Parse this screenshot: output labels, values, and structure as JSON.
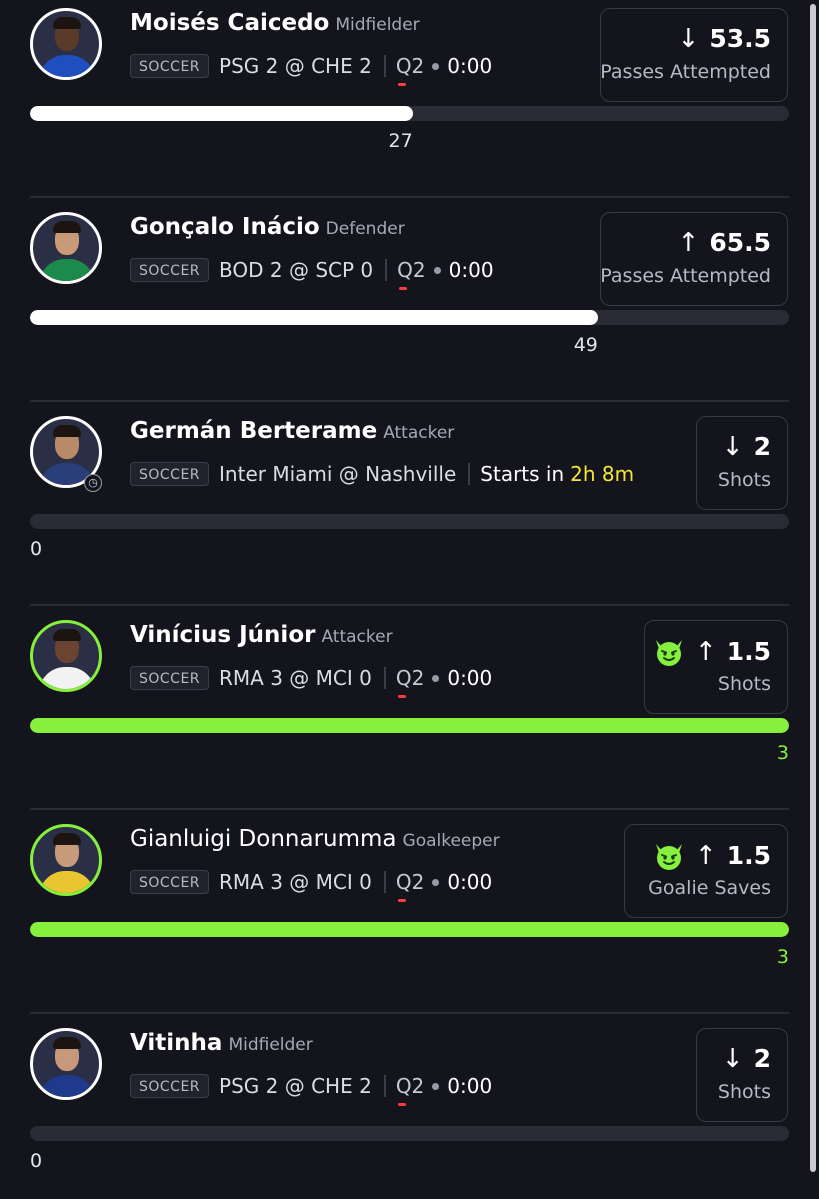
{
  "scrollbar": true,
  "colors": {
    "background": "#14141d",
    "win_accent": "#86f03c",
    "countdown": "#f5e63a",
    "live_indicator": "#ff3b3b"
  },
  "picks": [
    {
      "player": "Moisés Caicedo",
      "position": "Midfielder",
      "sport": "SOCCER",
      "matchup": "PSG 2 @ CHE 2",
      "period": "Q2",
      "clock": "0:00",
      "direction": "down",
      "arrow": "↓",
      "line": "53.5",
      "stat": "Passes Attempted",
      "current": "27",
      "progress_fraction": 0.504,
      "status": "live",
      "avatar_colors": {
        "skin": "#5a3a28",
        "shirt": "#1f4fbf"
      }
    },
    {
      "player": "Gonçalo Inácio",
      "position": "Defender",
      "sport": "SOCCER",
      "matchup": "BOD 2 @ SCP 0",
      "period": "Q2",
      "clock": "0:00",
      "direction": "up",
      "arrow": "↑",
      "line": "65.5",
      "stat": "Passes Attempted",
      "current": "49",
      "progress_fraction": 0.748,
      "status": "live",
      "avatar_colors": {
        "skin": "#c99a78",
        "shirt": "#1c8a4a"
      }
    },
    {
      "player": "Germán Berterame",
      "position": "Attacker",
      "sport": "SOCCER",
      "matchup": "Inter Miami @ Nashville",
      "starts_label": "Starts in",
      "starts_time": "2h 8m",
      "direction": "down",
      "arrow": "↓",
      "line": "2",
      "stat": "Shots",
      "current": "0",
      "progress_fraction": 0,
      "status": "upcoming",
      "avatar_colors": {
        "skin": "#b98a66",
        "shirt": "#2a3f7a"
      }
    },
    {
      "player": "Vinícius Júnior",
      "position": "Attacker",
      "sport": "SOCCER",
      "matchup": "RMA 3 @ MCI 0",
      "period": "Q2",
      "clock": "0:00",
      "direction": "up",
      "arrow": "↑",
      "line": "1.5",
      "stat": "Shots",
      "current": "3",
      "progress_fraction": 1,
      "status": "hit",
      "avatar_colors": {
        "skin": "#6a4430",
        "shirt": "#f2f2f2"
      }
    },
    {
      "player": "Gianluigi Donnarumma",
      "position": "Goalkeeper",
      "sport": "SOCCER",
      "matchup": "RMA 3 @ MCI 0",
      "period": "Q2",
      "clock": "0:00",
      "direction": "up",
      "arrow": "↑",
      "line": "1.5",
      "stat": "Goalie Saves",
      "current": "3",
      "progress_fraction": 1,
      "status": "hit",
      "avatar_colors": {
        "skin": "#c79a7a",
        "shirt": "#e8c531"
      }
    },
    {
      "player": "Vitinha",
      "position": "Midfielder",
      "sport": "SOCCER",
      "matchup": "PSG 2 @ CHE 2",
      "period": "Q2",
      "clock": "0:00",
      "direction": "down",
      "arrow": "↓",
      "line": "2",
      "stat": "Shots",
      "current": "0",
      "progress_fraction": 0,
      "status": "live",
      "avatar_colors": {
        "skin": "#c8987a",
        "shirt": "#1f3a8a"
      }
    }
  ]
}
